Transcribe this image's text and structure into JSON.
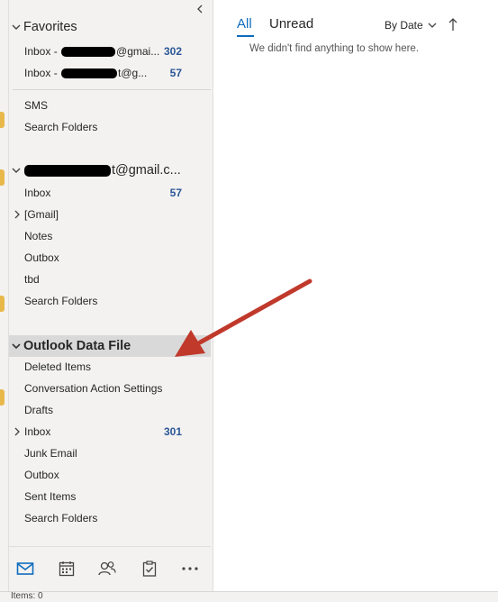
{
  "favorites": {
    "header_label": "Favorites",
    "items": [
      {
        "prefix": "Inbox - ",
        "suffix": "@gmai...",
        "count": "302"
      },
      {
        "prefix": "Inbox - ",
        "suffix": "t@g...",
        "count": "57"
      }
    ]
  },
  "misc": {
    "items": [
      {
        "label": "SMS"
      },
      {
        "label": "Search Folders"
      }
    ]
  },
  "gmail_account": {
    "header_suffix": "t@gmail.c...",
    "items": [
      {
        "label": "Inbox",
        "count": "57"
      },
      {
        "label": "[Gmail]"
      },
      {
        "label": "Notes"
      },
      {
        "label": "Outbox"
      },
      {
        "label": "tbd"
      },
      {
        "label": "Search Folders"
      }
    ]
  },
  "data_file": {
    "header_label": "Outlook Data File",
    "items": [
      {
        "label": "Deleted Items"
      },
      {
        "label": "Conversation Action Settings"
      },
      {
        "label": "Drafts"
      },
      {
        "label": "Inbox",
        "count": "301"
      },
      {
        "label": "Junk Email"
      },
      {
        "label": "Outbox"
      },
      {
        "label": "Sent Items"
      },
      {
        "label": "Search Folders"
      }
    ]
  },
  "bottom_nav": [
    "mail-icon",
    "calendar-icon",
    "people-icon",
    "tasks-icon",
    "more-icon"
  ],
  "message_list": {
    "tab_all": "All",
    "tab_unread": "Unread",
    "sort_label": "By Date",
    "empty_text": "We didn't find anything to show here."
  },
  "status_bar": {
    "text": "Items: 0"
  },
  "colors": {
    "accent": "#0f6cbd",
    "count": "#2b5797",
    "arrow": "#c0392b",
    "pane_bg": "#f3f2f1",
    "selected_bg": "#d9d9d9"
  }
}
